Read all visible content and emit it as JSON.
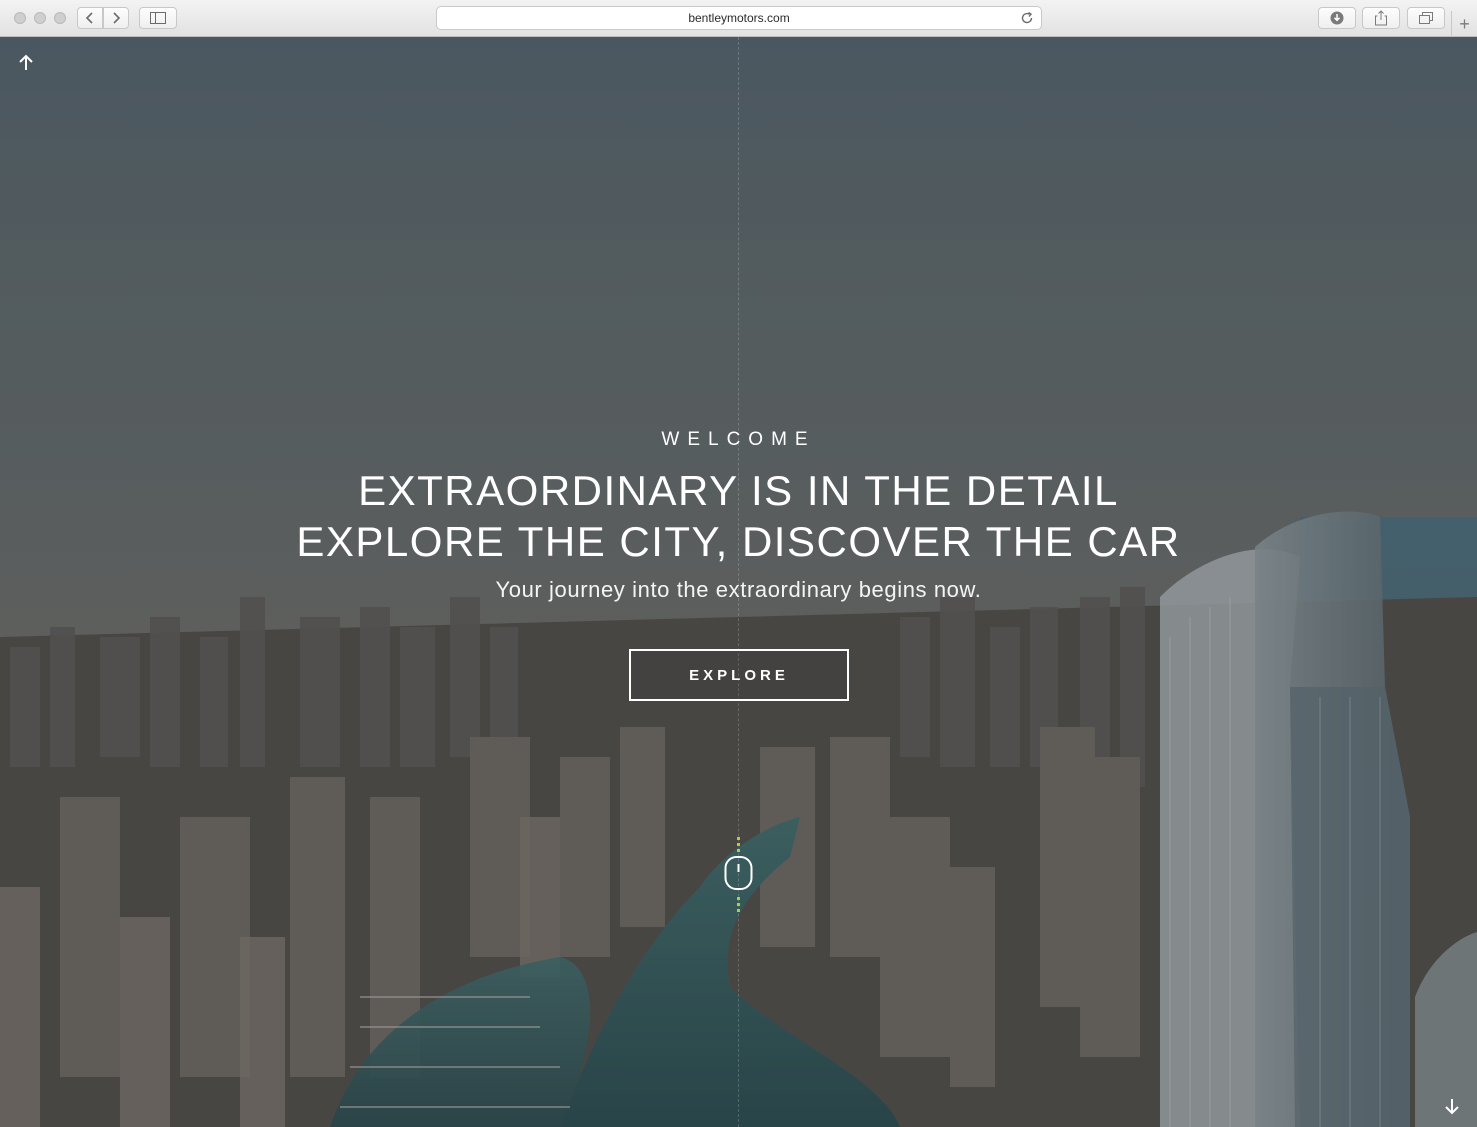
{
  "browser": {
    "url": "bentleymotors.com",
    "icons": {
      "back": "chevron-left-icon",
      "forward": "chevron-right-icon",
      "sidebar": "sidebar-icon",
      "reload": "reload-icon",
      "downloads": "download-icon",
      "share": "share-icon",
      "tabs": "tabs-icon",
      "new_tab": "plus-icon"
    },
    "new_tab_glyph": "+"
  },
  "hero": {
    "eyebrow": "WELCOME",
    "headline_line1": "EXTRAORDINARY IS IN THE DETAIL",
    "headline_line2": "EXPLORE THE CITY, DISCOVER THE CAR",
    "tagline": "Your journey into the extraordinary begins now.",
    "cta_label": "EXPLORE"
  },
  "colors": {
    "text": "#ffffff",
    "scroll_accent": "#a8d43a"
  }
}
